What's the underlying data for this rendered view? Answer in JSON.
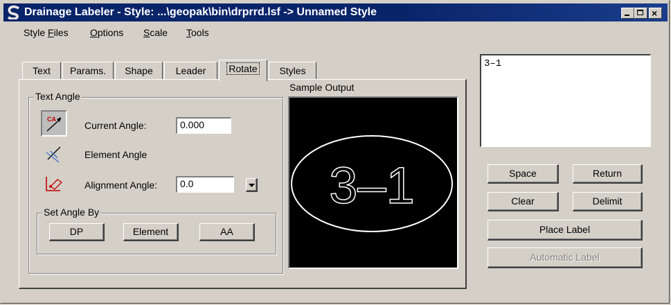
{
  "window": {
    "title": "Drainage Labeler - Style: ...\\geopak\\bin\\drprrd.lsf -> Unnamed Style"
  },
  "menu": [
    "Style Files",
    "Options",
    "Scale",
    "Tools"
  ],
  "menu_mnemonics": [
    "F",
    "O",
    "S",
    "T"
  ],
  "tabs": [
    "Text",
    "Params.",
    "Shape",
    "Leader",
    "Rotate",
    "Styles"
  ],
  "active_tab": "Rotate",
  "text_angle": {
    "group_label": "Text Angle",
    "current_angle_label": "Current Angle:",
    "current_angle_value": "0.000",
    "element_angle_label": "Element Angle",
    "alignment_angle_label": "Alignment Angle:",
    "alignment_angle_value": "0.0"
  },
  "set_angle_by": {
    "group_label": "Set Angle By",
    "buttons": [
      "DP",
      "Element",
      "AA"
    ]
  },
  "sample_output": {
    "label": "Sample Output",
    "text": "3–1"
  },
  "label_text": "3–1",
  "actions": {
    "space": "Space",
    "return": "Return",
    "clear": "Clear",
    "delimit": "Delimit",
    "place_label": "Place Label",
    "automatic_label": "Automatic Label"
  },
  "colors": {
    "title_bar": "#0a246a",
    "face": "#d4d0c8",
    "sample_bg": "#000000",
    "sample_fg": "#ffffff"
  }
}
